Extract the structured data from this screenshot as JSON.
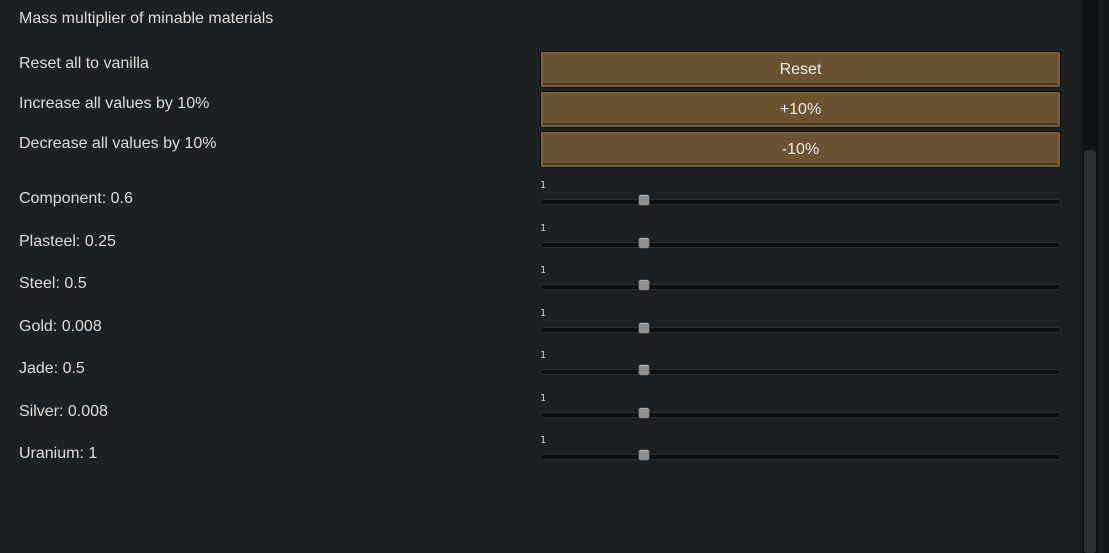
{
  "header": {
    "title": "Mass multiplier of minable materials"
  },
  "actions": [
    {
      "label": "Reset all to vanilla",
      "button": "Reset"
    },
    {
      "label": "Increase all values by 10%",
      "button": "+10%"
    },
    {
      "label": "Decrease all values by 10%",
      "button": "-10%"
    }
  ],
  "materials": [
    {
      "label": "Component: 0.6",
      "slider_value": "1",
      "slider_fraction": 0.2
    },
    {
      "label": "Plasteel: 0.25",
      "slider_value": "1",
      "slider_fraction": 0.2
    },
    {
      "label": "Steel: 0.5",
      "slider_value": "1",
      "slider_fraction": 0.2
    },
    {
      "label": "Gold: 0.008",
      "slider_value": "1",
      "slider_fraction": 0.2
    },
    {
      "label": "Jade: 0.5",
      "slider_value": "1",
      "slider_fraction": 0.2
    },
    {
      "label": "Silver: 0.008",
      "slider_value": "1",
      "slider_fraction": 0.2
    },
    {
      "label": "Uranium: 1",
      "slider_value": "1",
      "slider_fraction": 0.2
    }
  ],
  "scrollbar": {
    "position_fraction": 0.27
  }
}
